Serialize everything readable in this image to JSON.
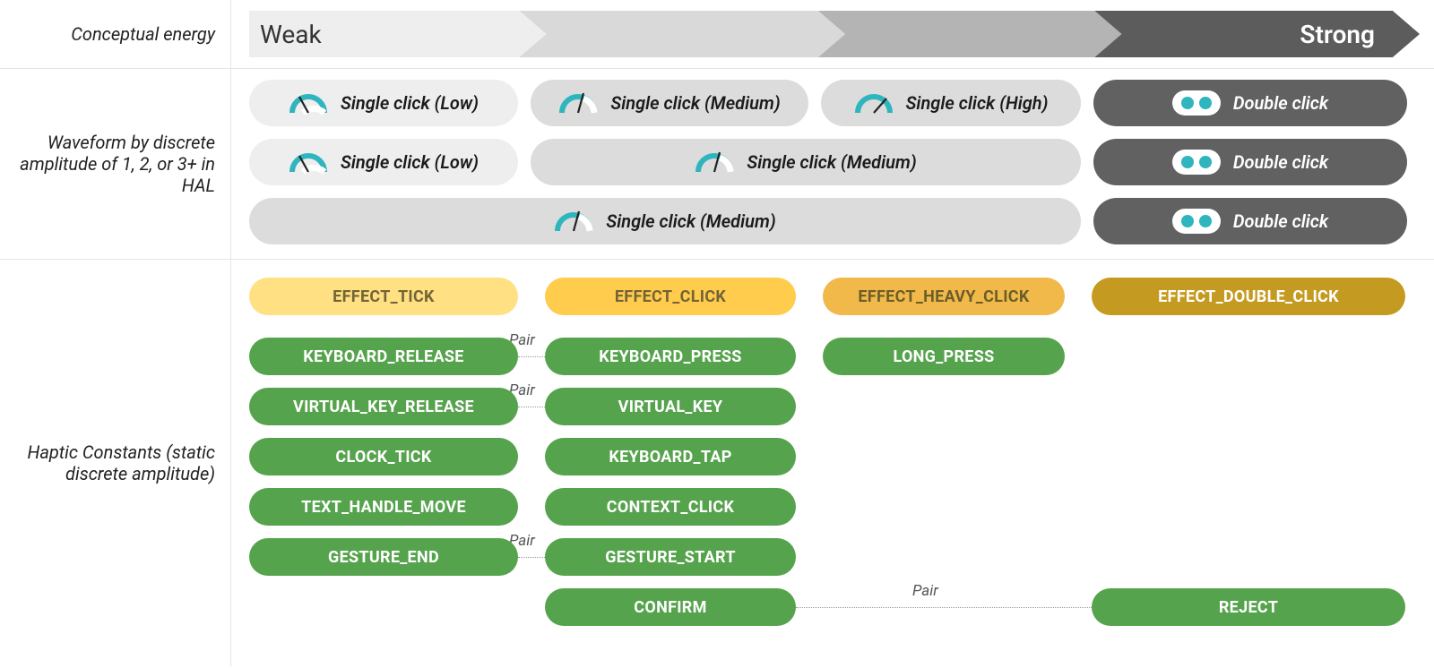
{
  "energy": {
    "label": "Conceptual energy",
    "weak": "Weak",
    "strong": "Strong"
  },
  "waveform": {
    "label": "Waveform by discrete amplitude of 1, 2, or 3+ in HAL",
    "single_low": "Single click (Low)",
    "single_med": "Single click (Medium)",
    "single_high": "Single click (High)",
    "double": "Double click"
  },
  "constants": {
    "label": "Haptic Constants (static discrete amplitude)",
    "pair_label": "Pair",
    "effects": {
      "tick": "EFFECT_TICK",
      "click": "EFFECT_CLICK",
      "heavy": "EFFECT_HEAVY_CLICK",
      "double": "EFFECT_DOUBLE_CLICK"
    },
    "col1": [
      "KEYBOARD_RELEASE",
      "VIRTUAL_KEY_RELEASE",
      "CLOCK_TICK",
      "TEXT_HANDLE_MOVE",
      "GESTURE_END"
    ],
    "col2": [
      "KEYBOARD_PRESS",
      "VIRTUAL_KEY",
      "KEYBOARD_TAP",
      "CONTEXT_CLICK",
      "GESTURE_START",
      "CONFIRM"
    ],
    "col3": [
      "LONG_PRESS"
    ],
    "col4": [
      "REJECT"
    ]
  }
}
